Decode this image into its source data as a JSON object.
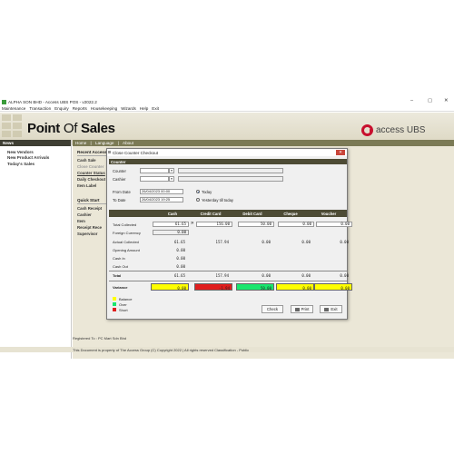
{
  "window": {
    "title": "ALPHA SON BHD - Access UBS POS - v2022.2",
    "controls": [
      "–",
      "▢",
      "✕"
    ]
  },
  "menu": [
    "Maintenance",
    "Transaction",
    "Enquiry",
    "Reports",
    "Housekeeping",
    "Wizards",
    "Help",
    "Exit"
  ],
  "brand": {
    "title_bold": "Point",
    "title_lite": " Of ",
    "title_bold2": "Sales",
    "logo_text": "access UBS",
    "logo_color": "#c8102e"
  },
  "sidebar": {
    "header": "News",
    "items": [
      "New Vendors",
      "New Product Arrivals",
      "Today's Sales"
    ]
  },
  "content": {
    "tabs": [
      "Home",
      "|",
      "Language",
      "|",
      "About"
    ],
    "recent_title": "Recent Access",
    "recent_items": [
      "Cash Sale",
      "Close Counter",
      "Counter Status",
      "Daily Checkout",
      "Item Label"
    ],
    "quick_title": "Quick Start",
    "quick_items": [
      "Cash Receipt",
      "Cashier",
      "Item",
      "Receipt Rece",
      "Supervisor"
    ]
  },
  "footer": {
    "registered": "Registered To : PC Mart Sdn Bhd",
    "copyright": "This Document is property of The Access Group (C) Copyright 2022 | All rights reserved   Classification - Public"
  },
  "dialog": {
    "title": "Close Counter Checkout",
    "section": "Counter",
    "counter_label": "Counter",
    "counter_value": "",
    "cashier_label": "Cashier",
    "cashier_value": "",
    "from_label": "From Date",
    "from_value": "26/04/2023 00:00",
    "to_label": "To Date",
    "to_value": "26/04/2023 19:25",
    "radio_today": "Today",
    "radio_yesterday": "Yesterday till today",
    "columns": [
      "Cash",
      "Credit Card",
      "Debit Card",
      "Cheque",
      "Voucher"
    ],
    "rows": {
      "total_collected": {
        "label": "Total Collected",
        "values": [
          "61.65",
          "156.00",
          "50.00",
          "0.00",
          "0.00"
        ]
      },
      "foreign_currency": {
        "label": "Foreign Currency",
        "value": "0.00"
      },
      "actual_collected": {
        "label": "Actual Collected",
        "values": [
          "61.65",
          "157.94",
          "0.00",
          "0.00",
          "0.00"
        ]
      },
      "opening_amount": {
        "label": "Opening Amount",
        "value": "0.00"
      },
      "cash_in": {
        "label": "Cash In",
        "value": "0.00"
      },
      "cash_out": {
        "label": "Cash Out",
        "value": "0.00"
      },
      "total": {
        "label": "Total",
        "values": [
          "61.65",
          "157.94",
          "0.00",
          "0.00",
          "0.00"
        ]
      },
      "variance": {
        "label": "Variance",
        "values": [
          "0.00",
          "-1.94",
          "50.00",
          "0.00",
          "0.00"
        ],
        "colors": [
          "#ffff00",
          "#e01e1e",
          "#19e66e",
          "#ffff00",
          "#ffff00"
        ]
      }
    },
    "legend": [
      {
        "label": "Balance",
        "color": "#ffff00"
      },
      {
        "label": "Over",
        "color": "#19e66e"
      },
      {
        "label": "Short",
        "color": "#e01e1e"
      }
    ],
    "buttons": {
      "check": "Check",
      "print": "Print",
      "exit": "Exit"
    }
  }
}
